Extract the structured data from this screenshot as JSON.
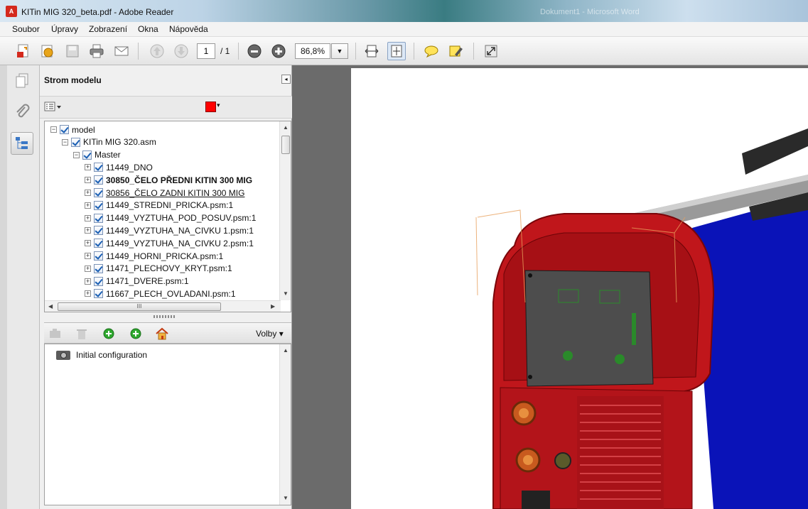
{
  "window": {
    "title": "KITin MIG 320_beta.pdf - Adobe Reader",
    "background_window": "Dokument1 - Microsoft Word"
  },
  "menu": [
    "Soubor",
    "Úpravy",
    "Zobrazení",
    "Okna",
    "Nápověda"
  ],
  "toolbar": {
    "icons": [
      "create-pdf-icon",
      "open-icon",
      "save-icon",
      "print-icon",
      "email-icon",
      "previous-page-icon",
      "next-page-icon",
      "zoom-out-icon",
      "zoom-in-icon",
      "fit-width-icon",
      "fit-page-icon",
      "comment-icon",
      "highlight-icon",
      "fullscreen-icon"
    ],
    "page_current": "1",
    "page_total": "/ 1",
    "zoom": "86,8%"
  },
  "left_rail": {
    "icons": [
      "pages-icon",
      "attachments-icon",
      "model-tree-icon"
    ],
    "active": "model-tree-icon"
  },
  "model_tree": {
    "title": "Strom modelu",
    "color": "#ff0000",
    "items": [
      {
        "label": "model",
        "level": 0,
        "bold": false,
        "underline": false
      },
      {
        "label": "KITin MIG 320.asm",
        "level": 1,
        "bold": false,
        "underline": false
      },
      {
        "label": "Master",
        "level": 2,
        "bold": false,
        "underline": false
      },
      {
        "label": "11449_DNO",
        "level": 3,
        "bold": false,
        "underline": false
      },
      {
        "label": "30850_ČELO PŘEDNI KITIN 300 MIG",
        "level": 3,
        "bold": true,
        "underline": false
      },
      {
        "label": "30856_ČELO ZADNI KITIN 300 MIG",
        "level": 3,
        "bold": false,
        "underline": true
      },
      {
        "label": "11449_STREDNI_PRICKA.psm:1",
        "level": 3,
        "bold": false,
        "underline": false
      },
      {
        "label": "11449_VYZTUHA_POD_POSUV.psm:1",
        "level": 3,
        "bold": false,
        "underline": false
      },
      {
        "label": "11449_VYZTUHA_NA_CIVKU 1.psm:1",
        "level": 3,
        "bold": false,
        "underline": false
      },
      {
        "label": "11449_VYZTUHA_NA_CIVKU 2.psm:1",
        "level": 3,
        "bold": false,
        "underline": false
      },
      {
        "label": "11449_HORNI_PRICKA.psm:1",
        "level": 3,
        "bold": false,
        "underline": false
      },
      {
        "label": "11471_PLECHOVY_KRYT.psm:1",
        "level": 3,
        "bold": false,
        "underline": false
      },
      {
        "label": "11471_DVERE.psm:1",
        "level": 3,
        "bold": false,
        "underline": false
      },
      {
        "label": "11667_PLECH_OVLADANI.psm:1",
        "level": 3,
        "bold": false,
        "underline": false
      }
    ],
    "hscroll_grip": "III"
  },
  "views_panel": {
    "options_label": "Volby ▾",
    "views": [
      "Initial configuration"
    ]
  },
  "colors": {
    "body_red": "#c0161b",
    "side_blue": "#0a13b8",
    "panel_gray": "#4d4d4d"
  }
}
